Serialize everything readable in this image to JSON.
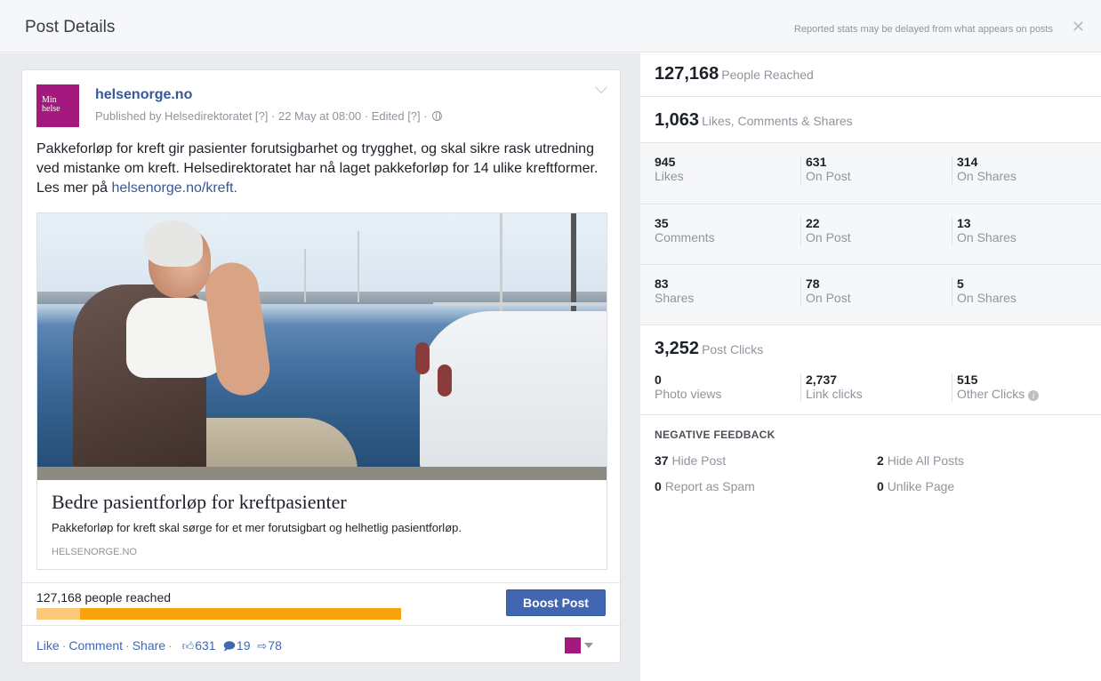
{
  "header": {
    "title": "Post Details",
    "note": "Reported stats may be delayed from what appears on posts",
    "close_label": "✕"
  },
  "post": {
    "avatar_line1": "Min",
    "avatar_line2": "helse",
    "page_name": "helsenorge.no",
    "meta": "Published by Helsedirektoratet [?] · 22 May at 08:00 · Edited [?] ·",
    "text_before_link": "Pakkeforløp for kreft gir pasienter forutsigbarhet og trygghet, og skal sikre rask utredning ved mistanke om kreft. Helsedirektoratet har nå laget pakkeforløp for 14 ulike kreftformer. Les mer på ",
    "text_link": "helsenorge.no/kreft.",
    "attachment": {
      "title": "Bedre pasientforløp for kreftpasienter",
      "description": "Pakkeforløp for kreft skal sørge for et mer forutsigbart og helhetlig pasientforløp.",
      "domain": "HELSENORGE.NO"
    },
    "reach_text": "127,168 people reached",
    "reach_bar": {
      "organic_fraction": 0.12
    },
    "boost_label": "Boost Post",
    "actions": {
      "like": "Like",
      "comment": "Comment",
      "share": "Share",
      "likes_count": "631",
      "comments_count": "19",
      "shares_count": "78"
    }
  },
  "stats": {
    "reached": {
      "value": "127,168",
      "label": "People Reached"
    },
    "engagement": {
      "value": "1,063",
      "label": "Likes, Comments & Shares"
    },
    "likes": {
      "total": "945",
      "total_label": "Likes",
      "on_post": "631",
      "on_post_label": "On Post",
      "on_shares": "314",
      "on_shares_label": "On Shares"
    },
    "comments": {
      "total": "35",
      "total_label": "Comments",
      "on_post": "22",
      "on_post_label": "On Post",
      "on_shares": "13",
      "on_shares_label": "On Shares"
    },
    "shares": {
      "total": "83",
      "total_label": "Shares",
      "on_post": "78",
      "on_post_label": "On Post",
      "on_shares": "5",
      "on_shares_label": "On Shares"
    },
    "clicks": {
      "value": "3,252",
      "label": "Post Clicks"
    },
    "photo_views": {
      "value": "0",
      "label": "Photo views"
    },
    "link_clicks": {
      "value": "2,737",
      "label": "Link clicks"
    },
    "other_clicks": {
      "value": "515",
      "label": "Other Clicks"
    },
    "negative": {
      "heading": "NEGATIVE FEEDBACK",
      "hide_post": {
        "value": "37",
        "label": "Hide Post"
      },
      "hide_all": {
        "value": "2",
        "label": "Hide All Posts"
      },
      "spam": {
        "value": "0",
        "label": "Report as Spam"
      },
      "unlike": {
        "value": "0",
        "label": "Unlike Page"
      }
    }
  },
  "colors": {
    "accent": "#4267b2",
    "avatar": "#a3197e",
    "reach_paid": "#f6a30d",
    "reach_organic": "#fcc97a"
  },
  "icons": [
    "close-icon",
    "globe-icon",
    "chevron-down-icon",
    "thumbs-up-icon",
    "comment-icon",
    "share-icon",
    "caret-icon",
    "info-icon"
  ]
}
